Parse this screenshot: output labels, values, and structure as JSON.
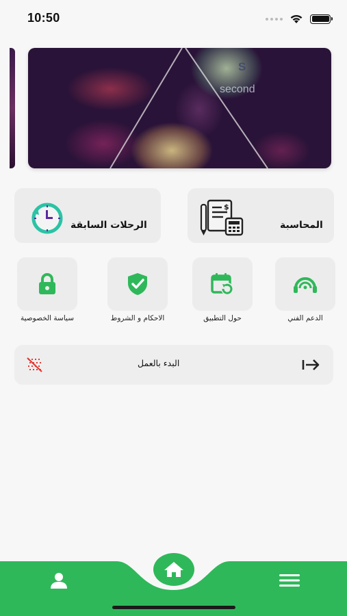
{
  "status_bar": {
    "time": "10:50"
  },
  "banner": {
    "overlay_text": "second",
    "overlay_letter": "S"
  },
  "cards": {
    "accounting_label": "المحاسبة",
    "previous_trips_label": "الرحلات السابقة"
  },
  "tiles": [
    {
      "label": "الدعم الفني",
      "icon": "headset-icon"
    },
    {
      "label": "حول التطبيق",
      "icon": "calendar-refresh-icon"
    },
    {
      "label": "الاحكام و الشروط",
      "icon": "shield-check-icon"
    },
    {
      "label": "سياسة الخصوصية",
      "icon": "lock-icon"
    }
  ],
  "start_row": {
    "label": "البدء بالعمل"
  },
  "bottom_nav": {
    "items": [
      "profile-icon",
      "home-icon",
      "menu-icon"
    ]
  },
  "colors": {
    "accent": "#2fb85a",
    "tile_bg": "#ececec",
    "page_bg": "#f7f7f7"
  }
}
